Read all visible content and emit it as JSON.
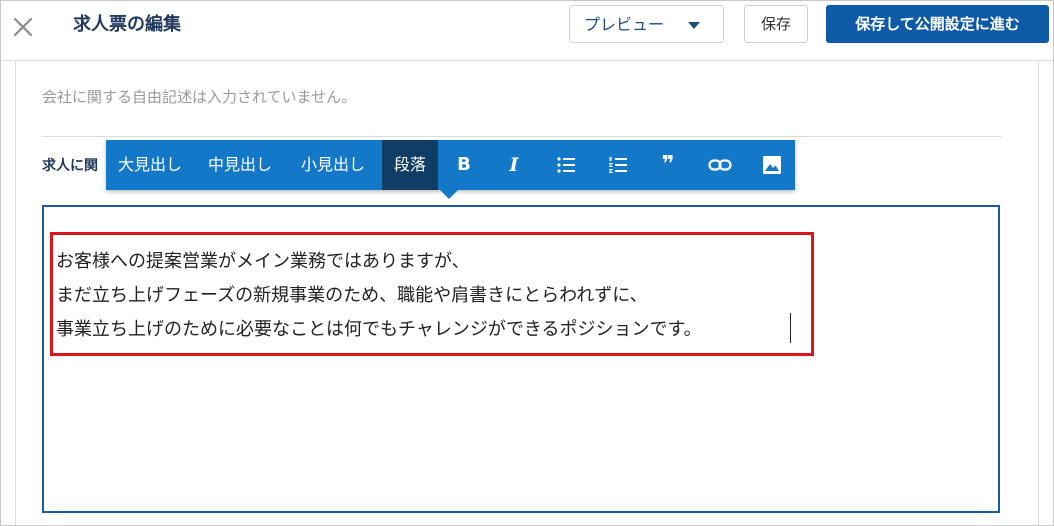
{
  "header": {
    "title": "求人票の編集",
    "preview_label": "プレビュー",
    "save_label": "保存",
    "save_publish_label": "保存して公開設定に進む"
  },
  "content": {
    "company_note": "会社に関する自由記述は入力されていません。",
    "section_label": "求人に関"
  },
  "toolbar": {
    "items": [
      {
        "label": "大見出し"
      },
      {
        "label": "中見出し"
      },
      {
        "label": "小見出し"
      },
      {
        "label": "段落",
        "active": true
      }
    ],
    "icons": [
      "bold-icon",
      "italic-icon",
      "bullet-list-icon",
      "numbered-list-icon",
      "quote-icon",
      "link-icon",
      "image-icon"
    ],
    "bold_glyph": "B",
    "italic_glyph": "I",
    "quote_glyph": "❞"
  },
  "editor": {
    "lines": [
      "お客様への提案営業がメイン業務ではありますが、",
      "まだ立ち上げフェーズの新規事業のため、職能や肩書きにとらわれずに、",
      "事業立ち上げのために必要なことは何でもチャレンジができるポジションです。"
    ]
  },
  "colors": {
    "primary": "#1478c8",
    "primary_dark": "#0f3d66",
    "button_blue": "#0f5aa6",
    "title_navy": "#223a5e",
    "highlight_red": "#d9161c",
    "editor_border": "#1f5aa0"
  }
}
